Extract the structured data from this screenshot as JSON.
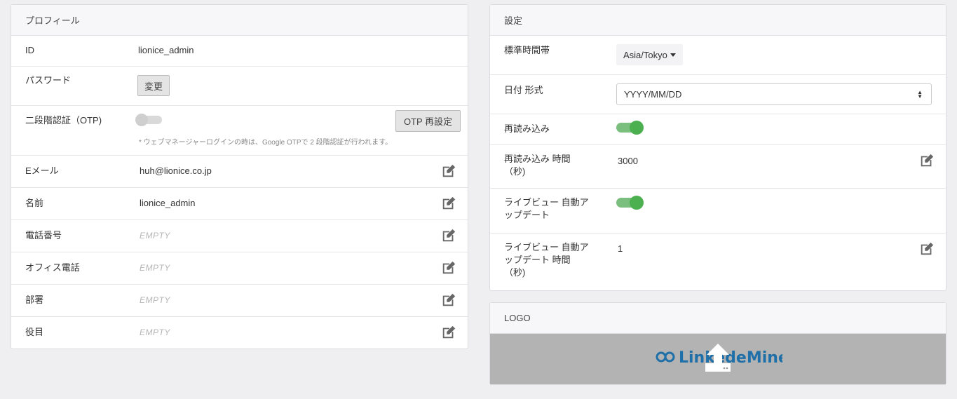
{
  "profile": {
    "title": "プロフィール",
    "id_label": "ID",
    "id_value": "lionice_admin",
    "password_label": "パスワード",
    "change_button": "変更",
    "otp_label": "二段階認証（OTP)",
    "otp_reset_button": "OTP 再設定",
    "otp_note": "* ウェブマネージャーログインの時は、Google OTPで 2 段階認証が行われます。",
    "email_label": "Eメール",
    "email_value": "huh@lionice.co.jp",
    "name_label": "名前",
    "name_value": "lionice_admin",
    "phone_label": "電話番号",
    "phone_value": "EMPTY",
    "office_phone_label": "オフィス電話",
    "office_phone_value": "EMPTY",
    "department_label": "部署",
    "department_value": "EMPTY",
    "role_label": "役目",
    "role_value": "EMPTY",
    "otp_enabled": false
  },
  "settings": {
    "title": "設定",
    "timezone_label": "標準時間帯",
    "timezone_value": "Asia/Tokyo",
    "date_format_label": "日付 形式",
    "date_format_value": "YYYY/MM/DD",
    "reload_label": "再読み込み",
    "reload_enabled": true,
    "reload_time_label_1": "再読み込み 時間",
    "reload_time_label_2": "（秒)",
    "reload_time_value": "3000",
    "live_auto_label_1": "ライブビュー 自動ア",
    "live_auto_label_2": "ップデート",
    "live_auto_enabled": true,
    "live_time_label_1": "ライブビュー 自動ア",
    "live_time_label_2": "ップデート 時間",
    "live_time_label_3": "（秒)",
    "live_time_value": "1"
  },
  "logo": {
    "title": "LOGO",
    "logo_text": "LinkedeMine",
    "upload_icon": "upload-icon"
  },
  "colors": {
    "toggle_on": "#4caf50",
    "logo_blue": "#1f6fa8",
    "logo_bg": "#b3b3b3"
  }
}
